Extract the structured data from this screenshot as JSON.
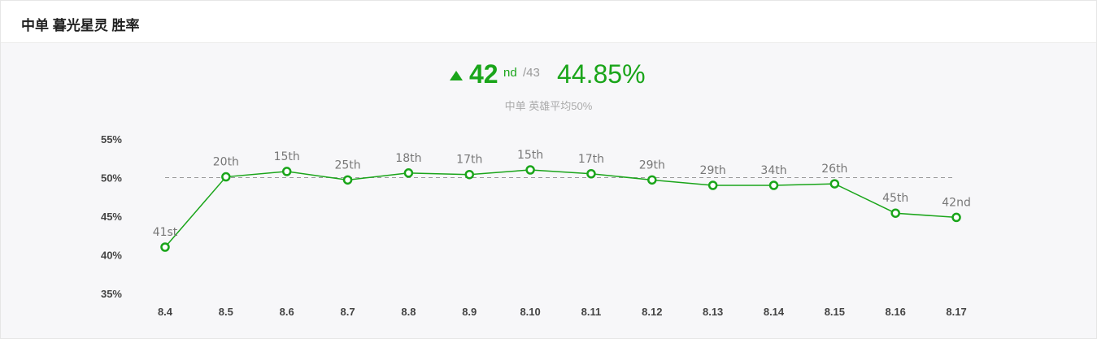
{
  "header": {
    "title": "中单 暮光星灵 胜率"
  },
  "summary": {
    "rank": "42",
    "rank_suffix": "nd",
    "rank_total": "/43",
    "win_rate": "44.85%",
    "subtitle": "中单 英雄平均50%",
    "trend": "up"
  },
  "colors": {
    "accent": "#1aa51a",
    "line": "#1aa51a",
    "avg_line": "#999999"
  },
  "chart_data": {
    "type": "line",
    "title": "",
    "xlabel": "",
    "ylabel": "",
    "categories": [
      "8.4",
      "8.5",
      "8.6",
      "8.7",
      "8.8",
      "8.9",
      "8.10",
      "8.11",
      "8.12",
      "8.13",
      "8.14",
      "8.15",
      "8.16",
      "8.17"
    ],
    "series": [
      {
        "values": [
          41.0,
          50.1,
          50.8,
          49.7,
          50.6,
          50.4,
          51.0,
          50.5,
          49.7,
          49.0,
          49.0,
          49.2,
          45.4,
          44.85
        ],
        "labels": [
          "41st",
          "20th",
          "15th",
          "25th",
          "18th",
          "17th",
          "15th",
          "17th",
          "29th",
          "29th",
          "34th",
          "26th",
          "45th",
          "42nd"
        ]
      }
    ],
    "reference_line": 50,
    "yticks": [
      "55%",
      "50%",
      "45%",
      "40%",
      "35%"
    ],
    "ytick_values": [
      55,
      50,
      45,
      40,
      35
    ],
    "ylim": [
      35,
      55
    ]
  }
}
